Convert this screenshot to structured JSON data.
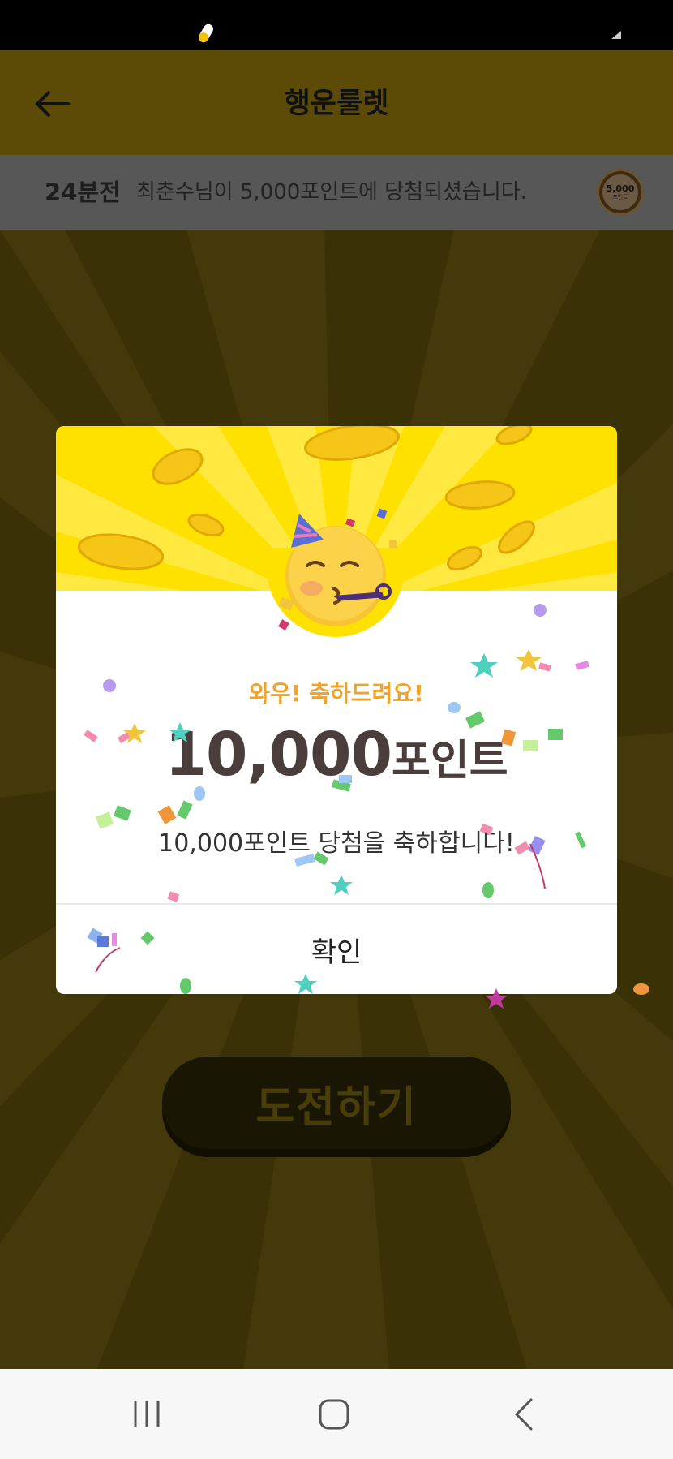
{
  "header": {
    "title": "행운룰렛",
    "back_icon": "arrow-left-icon"
  },
  "ticker": {
    "time": "24분전",
    "message": "최춘수님이 5,000포인트에 당첨되셨습니다.",
    "badge_value": "5,000",
    "badge_sub": "포인트"
  },
  "modal": {
    "wow": "와우! 축하드려요!",
    "points_number": "10,000",
    "points_unit": "포인트",
    "description": "10,000포인트 당첨을 축하합니다!",
    "confirm_label": "확인",
    "emoji": "partying-face-emoji"
  },
  "cta": {
    "label": "도전하기"
  },
  "navbar": {
    "icons": [
      "recent-apps-icon",
      "home-icon",
      "back-icon"
    ]
  },
  "colors": {
    "accent_yellow": "#ffe100",
    "wow_orange": "#f0a32b",
    "points_text": "#4a3d3c"
  }
}
